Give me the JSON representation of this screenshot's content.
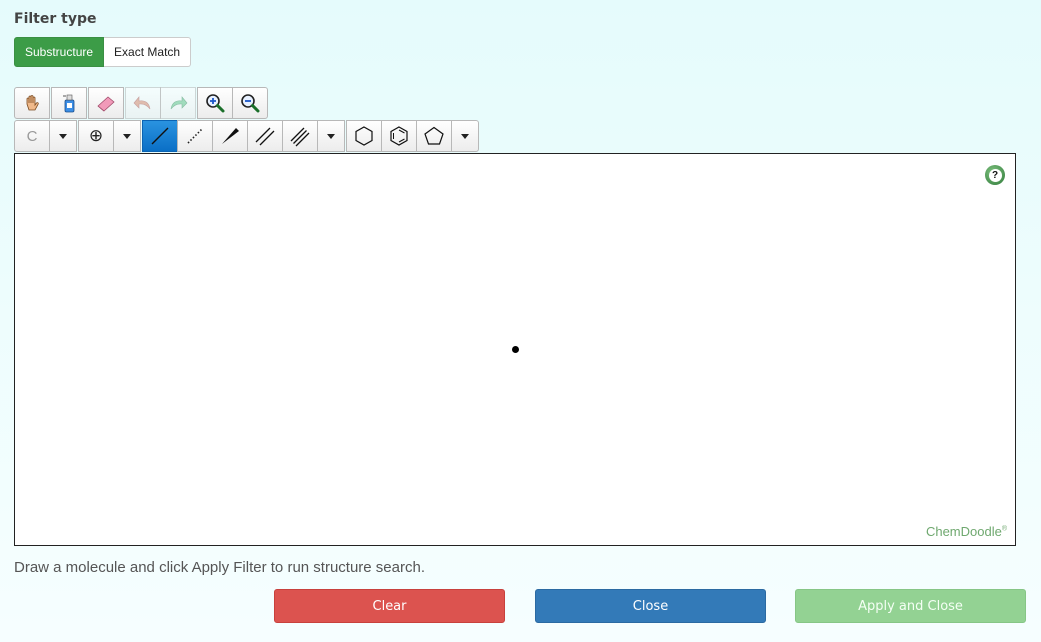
{
  "filter": {
    "title": "Filter type",
    "options": [
      "Substructure",
      "Exact Match"
    ],
    "selected": "Substructure"
  },
  "toolbar_top": [
    "hand-icon",
    "clear-bottle-icon",
    "eraser-icon",
    "undo-icon",
    "redo-icon",
    "zoom-in-icon",
    "zoom-out-icon"
  ],
  "toolbar_bottom": {
    "atom_label": "C",
    "charge_symbol": "⊕",
    "bond_tools": [
      "single-bond-icon",
      "recessed-bond-icon",
      "wedge-bond-icon",
      "double-bond-icon",
      "triple-bond-icon"
    ],
    "ring_tools": [
      "cyclohexane-icon",
      "benzene-icon",
      "cyclopentane-icon"
    ],
    "selected_tool": "single-bond-icon"
  },
  "canvas": {
    "help_symbol": "?",
    "brand": "ChemDoodle",
    "brand_mark": "®"
  },
  "hint": "Draw a molecule and click Apply Filter to run structure search.",
  "actions": {
    "clear": "Clear",
    "close": "Close",
    "apply": "Apply and Close"
  },
  "colors": {
    "active_green": "#3c9c47",
    "clear_red": "#dc534f",
    "close_blue": "#337ab8",
    "apply_disabled_green": "#93d293",
    "selected_tool_blue": "#0a6fc6"
  }
}
